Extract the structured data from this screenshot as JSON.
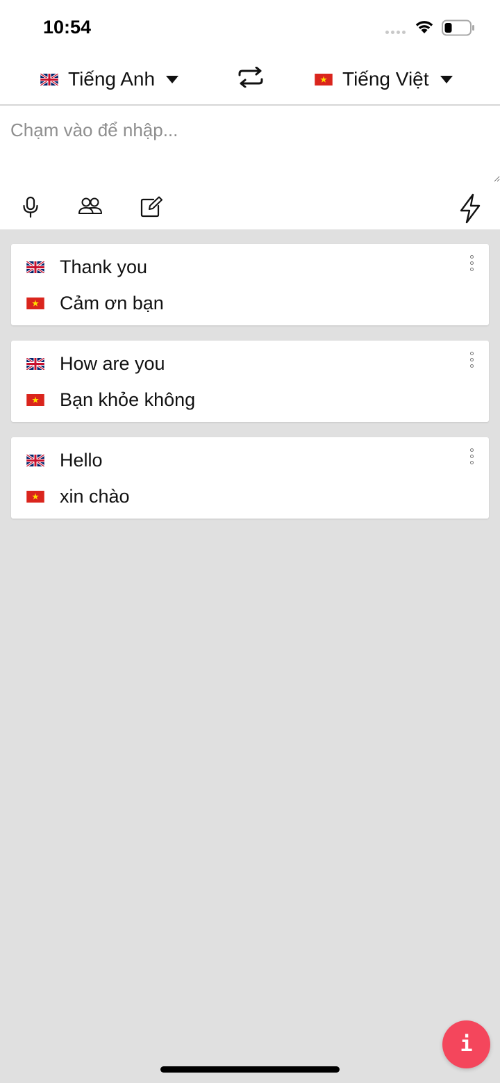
{
  "status_bar": {
    "time": "10:54",
    "icons": [
      "signal-dots-icon",
      "wifi-icon",
      "battery-icon"
    ]
  },
  "language_bar": {
    "source": {
      "label": "Tiếng Anh",
      "flag": "uk-flag-icon"
    },
    "target": {
      "label": "Tiếng Việt",
      "flag": "vietnam-flag-icon"
    },
    "swap_icon": "swap-arrows-icon"
  },
  "input": {
    "placeholder": "Chạm vào để nhập...",
    "value": ""
  },
  "toolbar": {
    "tools": [
      "microphone-icon",
      "conversation-people-icon",
      "edit-note-icon",
      "lightning-bolt-icon"
    ]
  },
  "history": [
    {
      "source": "Thank you",
      "target": "Cảm ơn bạn"
    },
    {
      "source": "How are you",
      "target": "Bạn khỏe không"
    },
    {
      "source": "Hello",
      "target": "xin chào"
    }
  ],
  "fab": {
    "label": "i",
    "color": "#f4465c"
  },
  "colors": {
    "background": "#e0e0e0",
    "surface": "#ffffff",
    "accent": "#f4465c",
    "vietnam_red": "#da251d",
    "vietnam_star": "#ffde00",
    "uk_blue": "#012169",
    "uk_red": "#c8102e"
  }
}
